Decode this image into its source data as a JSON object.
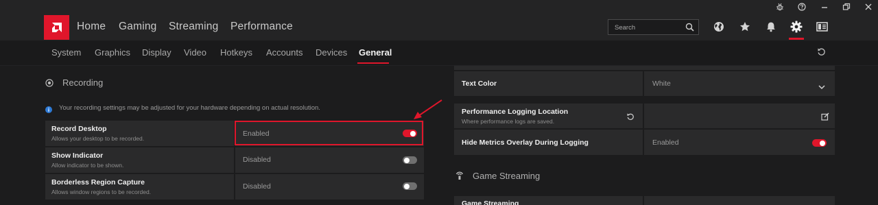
{
  "nav": {
    "items": [
      "Home",
      "Gaming",
      "Streaming",
      "Performance"
    ],
    "search_placeholder": "Search"
  },
  "subnav": {
    "items": [
      "System",
      "Graphics",
      "Display",
      "Video",
      "Hotkeys",
      "Accounts",
      "Devices",
      "General"
    ],
    "active": "General"
  },
  "recording": {
    "title": "Recording",
    "info": "Your recording settings may be adjusted for your hardware depending on actual resolution.",
    "rows": [
      {
        "label": "Record Desktop",
        "sub": "Allows your desktop to be recorded.",
        "value": "Enabled",
        "on": true
      },
      {
        "label": "Show Indicator",
        "sub": "Allow indicator to be shown.",
        "value": "Disabled",
        "on": false
      },
      {
        "label": "Borderless Region Capture",
        "sub": "Allows window regions to be recorded.",
        "value": "Disabled",
        "on": false
      }
    ]
  },
  "right": {
    "text_color": {
      "label": "Text Color",
      "value": "White"
    },
    "perf_log": {
      "label": "Performance Logging Location",
      "sub": "Where performance logs are saved."
    },
    "hide_metrics": {
      "label": "Hide Metrics Overlay During Logging",
      "value": "Enabled",
      "on": true
    },
    "game_streaming_title": "Game Streaming",
    "game_streaming_row": "Game Streaming"
  },
  "colors": {
    "accent": "#e0162b",
    "highlight": "#e0162b"
  },
  "icons": {
    "titlebar": [
      "bug-icon",
      "help-icon",
      "minimize-icon",
      "restore-icon",
      "close-icon"
    ],
    "nav": [
      "globe-icon",
      "star-icon",
      "bell-icon",
      "gear-icon",
      "layout-icon"
    ]
  }
}
